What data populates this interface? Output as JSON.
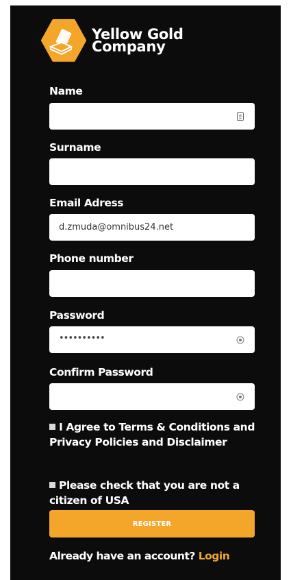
{
  "brand": {
    "line1": "Yellow Gold",
    "line2": "Company",
    "logo_icon": "gold-bars-hexagon-icon",
    "accent_color": "#f4a62a"
  },
  "form": {
    "name": {
      "label": "Name",
      "value": "",
      "icon": "contact-card-icon"
    },
    "surname": {
      "label": "Surname",
      "value": ""
    },
    "email": {
      "label": "Email Adress",
      "value": "d.zmuda@omnibus24.net"
    },
    "phone": {
      "label": "Phone number",
      "value": ""
    },
    "password": {
      "label": "Password",
      "value": "••••••••••",
      "icon": "eye-icon"
    },
    "confirm_password": {
      "label": "Confirm Password",
      "value": "",
      "icon": "eye-icon"
    }
  },
  "checks": {
    "terms": "I Agree to Terms & Conditions and Privacy Policies and Disclaimer",
    "usa": "Please check that you are not a citizen of USA"
  },
  "register_label": "REGISTER",
  "footer": {
    "prompt": "Already have an account?",
    "login_label": "Login"
  }
}
